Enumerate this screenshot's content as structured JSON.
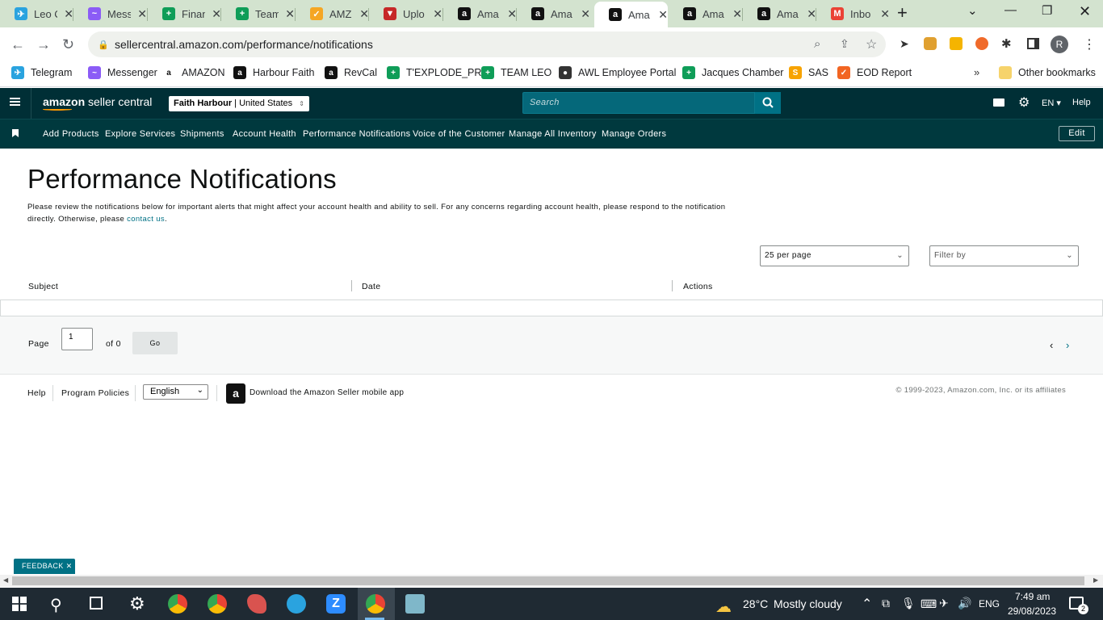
{
  "browser": {
    "tabs": [
      {
        "title": "Leo C",
        "icon": "telegram-icon",
        "color": "#2aa3df",
        "glyph": "✈"
      },
      {
        "title": "Mess",
        "icon": "messenger-icon",
        "color": "#8b5cf6",
        "glyph": "~"
      },
      {
        "title": "Finan",
        "icon": "sheets-icon",
        "color": "#0f9d58",
        "glyph": "+"
      },
      {
        "title": "Team",
        "icon": "sheets-icon",
        "color": "#0f9d58",
        "glyph": "+"
      },
      {
        "title": "AMZ",
        "icon": "clickup-icon",
        "color": "#f5a623",
        "glyph": "✓"
      },
      {
        "title": "Uplo",
        "icon": "upload-icon",
        "color": "#c62828",
        "glyph": "▼"
      },
      {
        "title": "Ama",
        "icon": "amazon-icon",
        "color": "#111",
        "glyph": "a"
      },
      {
        "title": "Ama",
        "icon": "amazon-icon",
        "color": "#111",
        "glyph": "a"
      },
      {
        "title": "Ama",
        "icon": "amazon-icon",
        "color": "#111",
        "glyph": "a",
        "active": true
      },
      {
        "title": "Ama",
        "icon": "amazon-icon",
        "color": "#111",
        "glyph": "a"
      },
      {
        "title": "Ama",
        "icon": "amazon-icon",
        "color": "#111",
        "glyph": "a"
      },
      {
        "title": "Inbo",
        "icon": "gmail-icon",
        "color": "#ea4335",
        "glyph": "M"
      }
    ],
    "url": "sellercentral.amazon.com/performance/notifications",
    "bookmarks": [
      {
        "label": "Telegram",
        "color": "#2aa3df",
        "glyph": "✈"
      },
      {
        "label": "Messenger",
        "color": "#8b5cf6",
        "glyph": "~"
      },
      {
        "label": "AMAZON",
        "color": "#fff",
        "glyph": "a"
      },
      {
        "label": "Harbour Faith",
        "color": "#111",
        "glyph": "a"
      },
      {
        "label": "RevCal",
        "color": "#111",
        "glyph": "a"
      },
      {
        "label": "T'EXPLODE_PR",
        "color": "#0f9d58",
        "glyph": "+"
      },
      {
        "label": "TEAM LEO",
        "color": "#0f9d58",
        "glyph": "+"
      },
      {
        "label": "AWL Employee Portal",
        "color": "#333",
        "glyph": "●"
      },
      {
        "label": "Jacques Chamber",
        "color": "#0f9d58",
        "glyph": "+"
      },
      {
        "label": "SAS",
        "color": "#f7a300",
        "glyph": "S"
      },
      {
        "label": "EOD Report",
        "color": "#f26522",
        "glyph": "✓"
      }
    ],
    "other_bookmarks": "Other bookmarks"
  },
  "header": {
    "logo_text": "amazon seller central",
    "account_store": "Faith Harbour",
    "account_region": "United States",
    "search_placeholder": "Search",
    "language": "EN",
    "help": "Help"
  },
  "nav": {
    "links": [
      "Add Products",
      "Explore Services",
      "Shipments",
      "Account Health",
      "Performance Notifications",
      "Voice of the Customer",
      "Manage All Inventory",
      "Manage Orders"
    ],
    "edit": "Edit"
  },
  "main": {
    "title": "Performance Notifications",
    "description": "Please review the notifications below for important alerts that might affect your account health and ability to sell. For any concerns regarding account health, please respond to the notification directly. Otherwise, please ",
    "contact_link": "contact us",
    "description_end": ".",
    "per_page": "25 per page",
    "filter": "Filter by",
    "columns": [
      "Subject",
      "Date",
      "Actions"
    ],
    "pager": {
      "page_label": "Page",
      "page_value": "1",
      "of_label": "of 0",
      "go": "Go"
    }
  },
  "footer": {
    "help": "Help",
    "program_policies": "Program Policies",
    "language": "English",
    "download_app": "Download the Amazon Seller mobile app",
    "copyright": "© 1999-2023, Amazon.com, Inc. or its affiliates"
  },
  "feedback": "FEEDBACK",
  "taskbar": {
    "weather_temp": "28°C",
    "weather_desc": "Mostly cloudy",
    "lang": "ENG",
    "time": "7:49 am",
    "date": "29/08/2023",
    "notifications": "2"
  }
}
